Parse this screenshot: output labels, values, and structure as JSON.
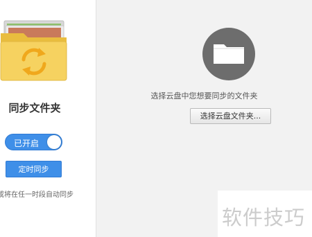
{
  "left_panel": {
    "title": "同步文件夹",
    "sync_toggle_label": "已开启",
    "schedule_button_label": "定时同步",
    "schedule_note": "或将在任一时段自动同步"
  },
  "right_panel": {
    "empty_hint": "选择云盘中您想要同步的文件夹",
    "choose_folder_button_label": "选择云盘文件夹..."
  },
  "watermark": {
    "text": "软件技巧"
  },
  "colors": {
    "accent_blue": "#3f8fe8",
    "folder_yellow": "#f6d260",
    "sync_arrows_orange": "#f0a81c",
    "folder_circle_gray": "#6d6d6d",
    "right_panel_bg": "#f2f2f2"
  },
  "icons": {
    "folder_illustration": "folder-sync-icon",
    "empty_state": "folder-icon"
  }
}
